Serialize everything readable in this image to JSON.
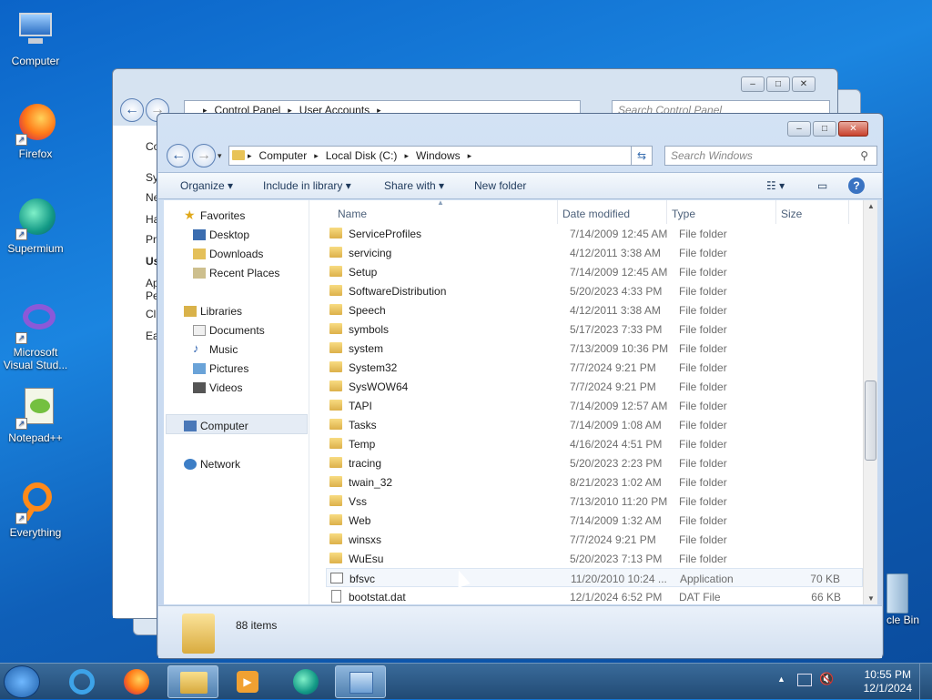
{
  "desktop": {
    "icons": [
      {
        "label": "Computer"
      },
      {
        "label": "Firefox"
      },
      {
        "label": "Supermium"
      },
      {
        "label": "Microsoft Visual Stud..."
      },
      {
        "label": "Notepad++"
      },
      {
        "label": "Everything"
      },
      {
        "label": "cle Bin"
      }
    ]
  },
  "back_window": {
    "breadcrumb": [
      "Control Panel",
      "User Accounts"
    ],
    "search_placeholder": "Search Control Panel",
    "left_items": [
      "Co",
      "Sy",
      "Ne",
      "Ha",
      "Pr",
      "Us",
      "Ap",
      "Pe",
      "Cl",
      "Ea"
    ]
  },
  "explorer": {
    "breadcrumb": [
      "Computer",
      "Local Disk (C:)",
      "Windows"
    ],
    "search_placeholder": "Search Windows",
    "toolbar": {
      "organize": "Organize",
      "include": "Include in library",
      "share": "Share with",
      "new_folder": "New folder"
    },
    "nav": {
      "favorites": "Favorites",
      "desktop": "Desktop",
      "downloads": "Downloads",
      "recent": "Recent Places",
      "libraries": "Libraries",
      "documents": "Documents",
      "music": "Music",
      "pictures": "Pictures",
      "videos": "Videos",
      "computer": "Computer",
      "network": "Network"
    },
    "columns": {
      "name": "Name",
      "date": "Date modified",
      "type": "Type",
      "size": "Size"
    },
    "rows": [
      {
        "name": "ServiceProfiles",
        "date": "7/14/2009 12:45 AM",
        "type": "File folder",
        "size": ""
      },
      {
        "name": "servicing",
        "date": "4/12/2011 3:38 AM",
        "type": "File folder",
        "size": ""
      },
      {
        "name": "Setup",
        "date": "7/14/2009 12:45 AM",
        "type": "File folder",
        "size": ""
      },
      {
        "name": "SoftwareDistribution",
        "date": "5/20/2023 4:33 PM",
        "type": "File folder",
        "size": ""
      },
      {
        "name": "Speech",
        "date": "4/12/2011 3:38 AM",
        "type": "File folder",
        "size": ""
      },
      {
        "name": "symbols",
        "date": "5/17/2023 7:33 PM",
        "type": "File folder",
        "size": ""
      },
      {
        "name": "system",
        "date": "7/13/2009 10:36 PM",
        "type": "File folder",
        "size": ""
      },
      {
        "name": "System32",
        "date": "7/7/2024 9:21 PM",
        "type": "File folder",
        "size": ""
      },
      {
        "name": "SysWOW64",
        "date": "7/7/2024 9:21 PM",
        "type": "File folder",
        "size": ""
      },
      {
        "name": "TAPI",
        "date": "7/14/2009 12:57 AM",
        "type": "File folder",
        "size": ""
      },
      {
        "name": "Tasks",
        "date": "7/14/2009 1:08 AM",
        "type": "File folder",
        "size": ""
      },
      {
        "name": "Temp",
        "date": "4/16/2024 4:51 PM",
        "type": "File folder",
        "size": ""
      },
      {
        "name": "tracing",
        "date": "5/20/2023 2:23 PM",
        "type": "File folder",
        "size": ""
      },
      {
        "name": "twain_32",
        "date": "8/21/2023 1:02 AM",
        "type": "File folder",
        "size": ""
      },
      {
        "name": "Vss",
        "date": "7/13/2010 11:20 PM",
        "type": "File folder",
        "size": ""
      },
      {
        "name": "Web",
        "date": "7/14/2009 1:32 AM",
        "type": "File folder",
        "size": ""
      },
      {
        "name": "winsxs",
        "date": "7/7/2024 9:21 PM",
        "type": "File folder",
        "size": ""
      },
      {
        "name": "WuEsu",
        "date": "5/20/2023 7:13 PM",
        "type": "File folder",
        "size": ""
      },
      {
        "name": "bfsvc",
        "date": "11/20/2010 10:24 ...",
        "type": "Application",
        "size": "70 KB"
      },
      {
        "name": "bootstat.dat",
        "date": "12/1/2024 6:52 PM",
        "type": "DAT File",
        "size": "66 KB"
      }
    ],
    "status": "88 items"
  },
  "taskbar": {
    "time": "10:55 PM",
    "date": "12/1/2024"
  }
}
